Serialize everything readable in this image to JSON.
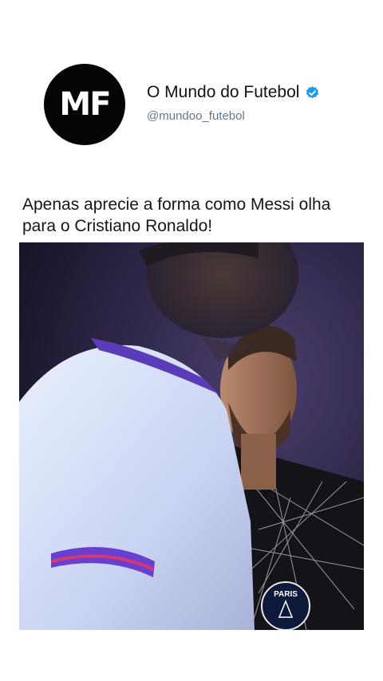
{
  "account": {
    "avatar_initials": "MF",
    "display_name": "O Mundo do Futebol",
    "handle": "@mundoo_futebol",
    "verified": true,
    "verified_icon": "verified-badge-icon",
    "verified_color": "#1d9bf0"
  },
  "post": {
    "text": "Apenas aprecie a forma como Messi olha para o Cristiano Ronaldo!"
  },
  "media": {
    "crest_text": "PARIS"
  }
}
